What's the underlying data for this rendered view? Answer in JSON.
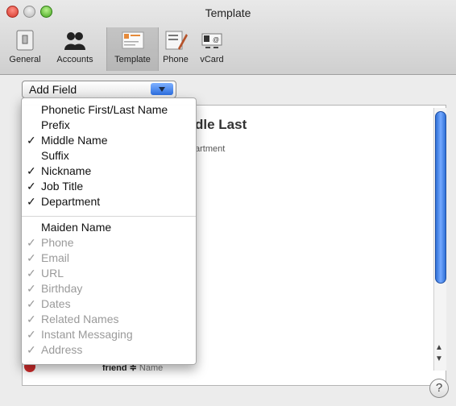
{
  "window": {
    "title": "Template"
  },
  "toolbar": {
    "items": [
      {
        "label": "General",
        "icon": "general-icon"
      },
      {
        "label": "Accounts",
        "icon": "accounts-icon"
      },
      {
        "label": "Template",
        "icon": "template-icon"
      },
      {
        "label": "Phone",
        "icon": "phone-icon"
      },
      {
        "label": "vCard",
        "icon": "vcard-icon"
      }
    ],
    "selected": "Template"
  },
  "add_field": {
    "label": "Add Field"
  },
  "card": {
    "name_fragment": "dle Last",
    "dept_fragment": "artment",
    "friend_label": "friend ≑",
    "friend_value": "Name"
  },
  "menu": {
    "items_top": [
      {
        "label": "Phonetic First/Last Name",
        "checked": false
      },
      {
        "label": "Prefix",
        "checked": false
      },
      {
        "label": "Middle Name",
        "checked": true
      },
      {
        "label": "Suffix",
        "checked": false
      },
      {
        "label": "Nickname",
        "checked": true
      },
      {
        "label": "Job Title",
        "checked": true
      },
      {
        "label": "Department",
        "checked": true
      }
    ],
    "items_bottom": [
      {
        "label": "Maiden Name",
        "checked": false,
        "disabled": false
      },
      {
        "label": "Phone",
        "checked": true,
        "disabled": true
      },
      {
        "label": "Email",
        "checked": true,
        "disabled": true
      },
      {
        "label": "URL",
        "checked": true,
        "disabled": true
      },
      {
        "label": "Birthday",
        "checked": true,
        "disabled": true
      },
      {
        "label": "Dates",
        "checked": true,
        "disabled": true
      },
      {
        "label": "Related Names",
        "checked": true,
        "disabled": true
      },
      {
        "label": "Instant Messaging",
        "checked": true,
        "disabled": true
      },
      {
        "label": "Address",
        "checked": true,
        "disabled": true
      }
    ],
    "check_glyph": "✓"
  },
  "help": {
    "label": "?"
  }
}
